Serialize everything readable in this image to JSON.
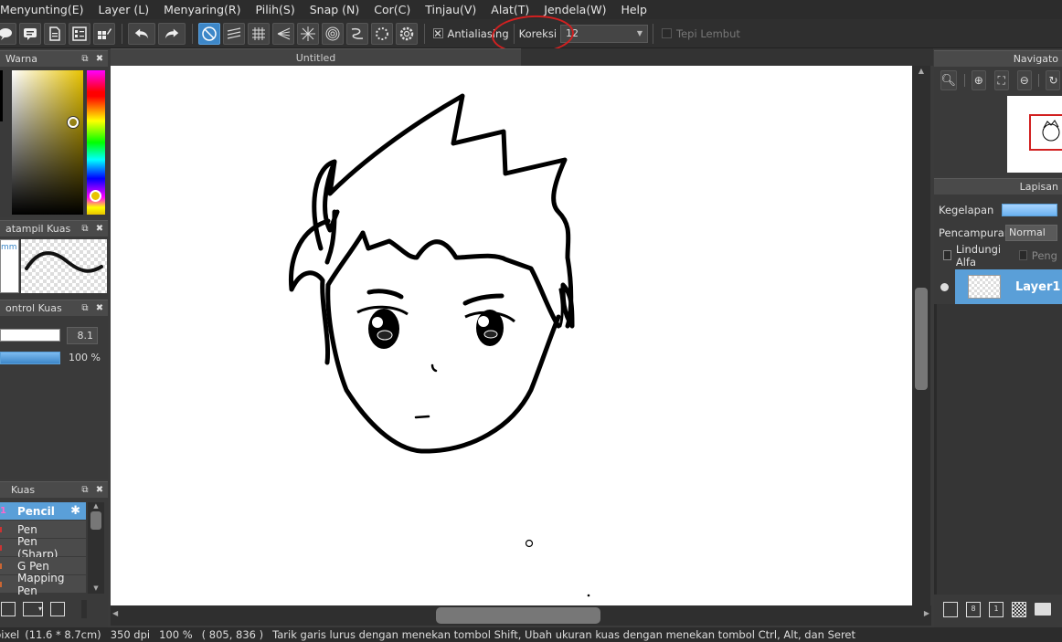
{
  "menu": [
    "Menyunting(E)",
    "Layer (L)",
    "Menyaring(R)",
    "Pilih(S)",
    "Snap (N)",
    "Cor(C)",
    "Tinjau(V)",
    "Alat(T)",
    "Jendela(W)",
    "Help"
  ],
  "toolbar": {
    "antialiasing_label": "Antialiasing",
    "koreksi_label": "Koreksi",
    "koreksi_value": "12",
    "tepi_lembut_label": "Tepi Lembut"
  },
  "panels": {
    "warna_title": "Warna",
    "tampil_kuas_title": "atampil Kuas",
    "tampil_kuas_size": "mm",
    "control_kuas_title": "ontrol Kuas",
    "brush_size": "8.1",
    "brush_opacity": "100 %",
    "kuas_title": "Kuas",
    "navigator_title": "Navigato",
    "lapisan_title": "Lapisan"
  },
  "brushes": [
    {
      "num": "1",
      "name": "Pencil",
      "selected": true
    },
    {
      "num": "",
      "name": "Pen",
      "selected": false
    },
    {
      "num": "",
      "name": "Pen (Sharp)",
      "selected": false
    },
    {
      "num": "",
      "name": "G Pen",
      "selected": false
    },
    {
      "num": "",
      "name": "Mapping Pen",
      "selected": false
    }
  ],
  "document": {
    "tab_title": "Untitled"
  },
  "layers_panel": {
    "opacity_label": "Kegelapan",
    "blend_label": "Pencampuran",
    "blend_value": "Normal",
    "protect_alpha_label": "Lindungi Alfa",
    "clip_label": "Peng",
    "layer_name": "Layer1"
  },
  "status": {
    "unit": "pixel",
    "size": "(11.6 * 8.7cm)",
    "dpi": "350 dpi",
    "zoom": "100 %",
    "coords": "( 805, 836 )",
    "hint": "Tarik garis lurus dengan menekan tombol Shift, Ubah ukuran kuas dengan menekan tombol Ctrl, Alt, dan Seret"
  },
  "colors": {
    "accent": "#5a9fd8",
    "annotation": "#d12020",
    "hue_marker": "#e8c300"
  },
  "icons": [
    "speech-bubble-icon",
    "comment-icon",
    "page-icon",
    "page-list-icon",
    "page-edit-icon",
    "undo-icon",
    "redo-icon",
    "no-snap-icon",
    "parallel-snap-icon",
    "grid-snap-icon",
    "vanishing-snap-icon",
    "radial-snap-icon",
    "concentric-snap-icon",
    "curve-snap-icon",
    "circle-snap-icon",
    "snap-settings-icon"
  ]
}
